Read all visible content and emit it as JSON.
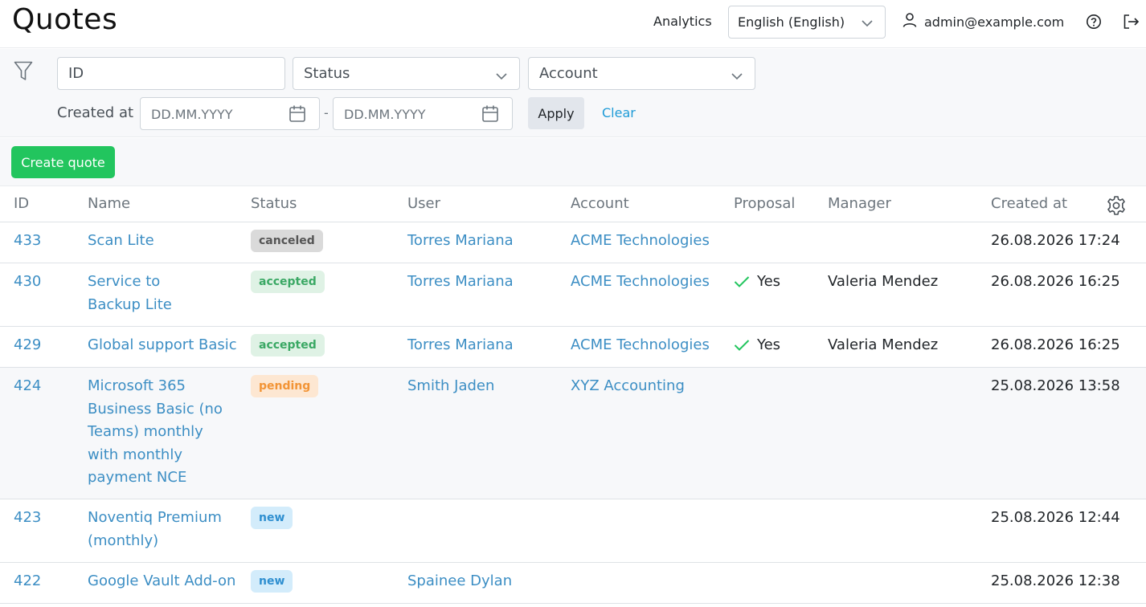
{
  "header": {
    "title": "Quotes",
    "analytics": "Analytics",
    "language": "English (English)",
    "user": "admin@example.com"
  },
  "filters": {
    "id_placeholder": "ID",
    "status_placeholder": "Status",
    "account_placeholder": "Account",
    "created_label": "Created at",
    "date_placeholder": "DD.MM.YYYY",
    "date_separator": "-",
    "apply": "Apply",
    "clear": "Clear"
  },
  "toolbar": {
    "create": "Create quote"
  },
  "table": {
    "columns": [
      "ID",
      "Name",
      "Status",
      "User",
      "Account",
      "Proposal",
      "Manager",
      "Created at"
    ],
    "rows": [
      {
        "id": "433",
        "name": "Scan Lite",
        "status": "canceled",
        "user": "Torres Mariana",
        "account": "ACME Technologies",
        "proposal": "",
        "manager": "",
        "created": "26.08.2026 17:24"
      },
      {
        "id": "430",
        "name": "Service to Backup Lite",
        "status": "accepted",
        "user": "Torres Mariana",
        "account": "ACME Technologies",
        "proposal": "Yes",
        "manager": "Valeria Mendez",
        "created": "26.08.2026 16:25"
      },
      {
        "id": "429",
        "name": "Global support Basic",
        "status": "accepted",
        "user": "Torres Mariana",
        "account": "ACME Technologies",
        "proposal": "Yes",
        "manager": "Valeria Mendez",
        "created": "26.08.2026 16:25"
      },
      {
        "id": "424",
        "name": "Microsoft 365 Business Basic (no Teams) monthly with monthly payment NCE",
        "status": "pending",
        "user": "Smith Jaden",
        "account": "XYZ Accounting",
        "proposal": "",
        "manager": "",
        "created": "25.08.2026 13:58"
      },
      {
        "id": "423",
        "name": "Noventiq Premium (monthly)",
        "status": "new",
        "user": "",
        "account": "",
        "proposal": "",
        "manager": "",
        "created": "25.08.2026 12:44"
      },
      {
        "id": "422",
        "name": "Google Vault Add-on",
        "status": "new",
        "user": "Spainee Dylan",
        "account": "",
        "proposal": "",
        "manager": "",
        "created": "25.08.2026 12:38"
      }
    ]
  },
  "colors": {
    "link": "#3c8ec4",
    "create_button": "#22c55e",
    "badge_canceled": "#dadada",
    "badge_accepted": "#dff2e5",
    "badge_pending": "#fde7d2",
    "badge_new": "#d3ecfb"
  }
}
